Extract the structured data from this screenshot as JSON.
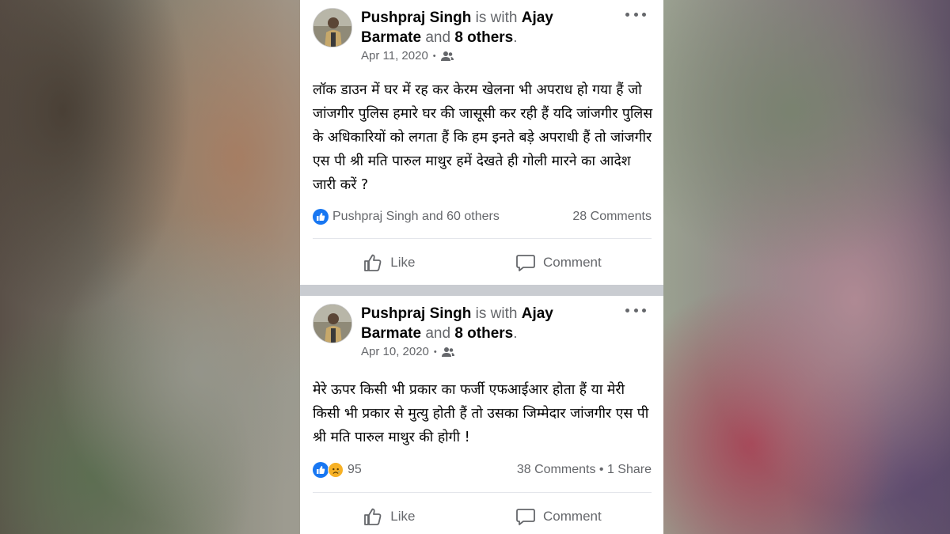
{
  "posts": [
    {
      "author": "Pushpraj Singh",
      "with_text": "is with",
      "tagged": "Ajay Barmate",
      "and_text": "and",
      "others": "8 others",
      "end": ".",
      "date": "Apr 11, 2020",
      "privacy_icon": "friends-icon",
      "text": "लॉक डाउन में घर में रह कर केरम खेलना भी अपराध हो गया हैं जो जांजगीर पुलिस हमारे घर की जासूसी कर रही हैं यदि जांजगीर पुलिस के अधिकारियों को लगता हैं कि हम इनते बड़े अपराधी हैं तो जांजगीर एस पी श्री मति पारुल माथुर हमें देखते ही गोली मारने का आदेश जारी करें ?",
      "reactions": "Pushpraj Singh and 60 others",
      "comments": "28 Comments",
      "shares": "",
      "like_label": "Like",
      "comment_label": "Comment"
    },
    {
      "author": "Pushpraj Singh",
      "with_text": "is with",
      "tagged": "Ajay Barmate",
      "and_text": "and",
      "others": "8 others",
      "end": ".",
      "date": "Apr 10, 2020",
      "privacy_icon": "friends-icon",
      "text": "मेरे ऊपर किसी भी प्रकार का फर्जी एफआईआर होता हैं या मेरी किसी भी प्रकार से मुत्यु होती हैं तो उसका जिम्मेदार जांजगीर एस पी श्री मति पारुल माथुर की होगी !",
      "reactions": "95",
      "comments": "38 Comments",
      "shares": "1 Share",
      "like_label": "Like",
      "comment_label": "Comment"
    }
  ],
  "colors": {
    "like_blue": "#1877f2",
    "sad_yellow": "#f7b125",
    "secondary_text": "#65676b",
    "feed_divider": "#c9ccd1"
  }
}
